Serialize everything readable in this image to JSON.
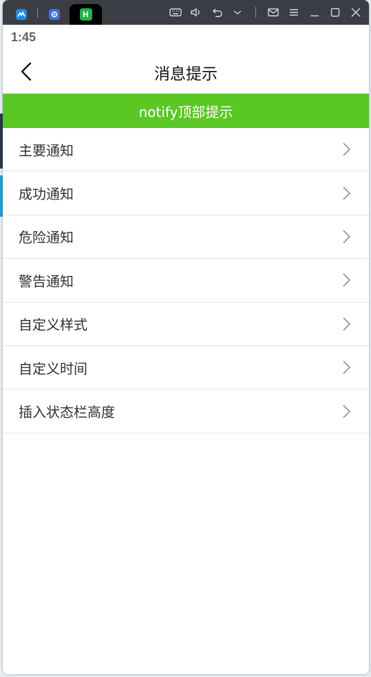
{
  "titlebar": {
    "tabs": [
      {
        "icon": "app-logo-icon",
        "color": "#1e88e5"
      },
      {
        "icon": "gear-icon",
        "color": "#3f6fe0"
      },
      {
        "icon": "h-app-icon",
        "color": "#22b14c",
        "letter": "H"
      }
    ],
    "controls": [
      "keyboard-icon",
      "volume-icon",
      "undo-icon",
      "chevron-down-icon",
      "mail-icon",
      "menu-icon",
      "minimize-icon",
      "maximize-icon",
      "close-icon"
    ]
  },
  "statusbar": {
    "time": "1:45"
  },
  "navbar": {
    "title": "消息提示"
  },
  "notify": {
    "text": "notify顶部提示",
    "color": "#5ac725"
  },
  "list": {
    "items": [
      {
        "label": "主要通知"
      },
      {
        "label": "成功通知"
      },
      {
        "label": "危险通知"
      },
      {
        "label": "警告通知"
      },
      {
        "label": "自定义样式"
      },
      {
        "label": "自定义时间"
      },
      {
        "label": "插入状态栏高度"
      }
    ]
  }
}
